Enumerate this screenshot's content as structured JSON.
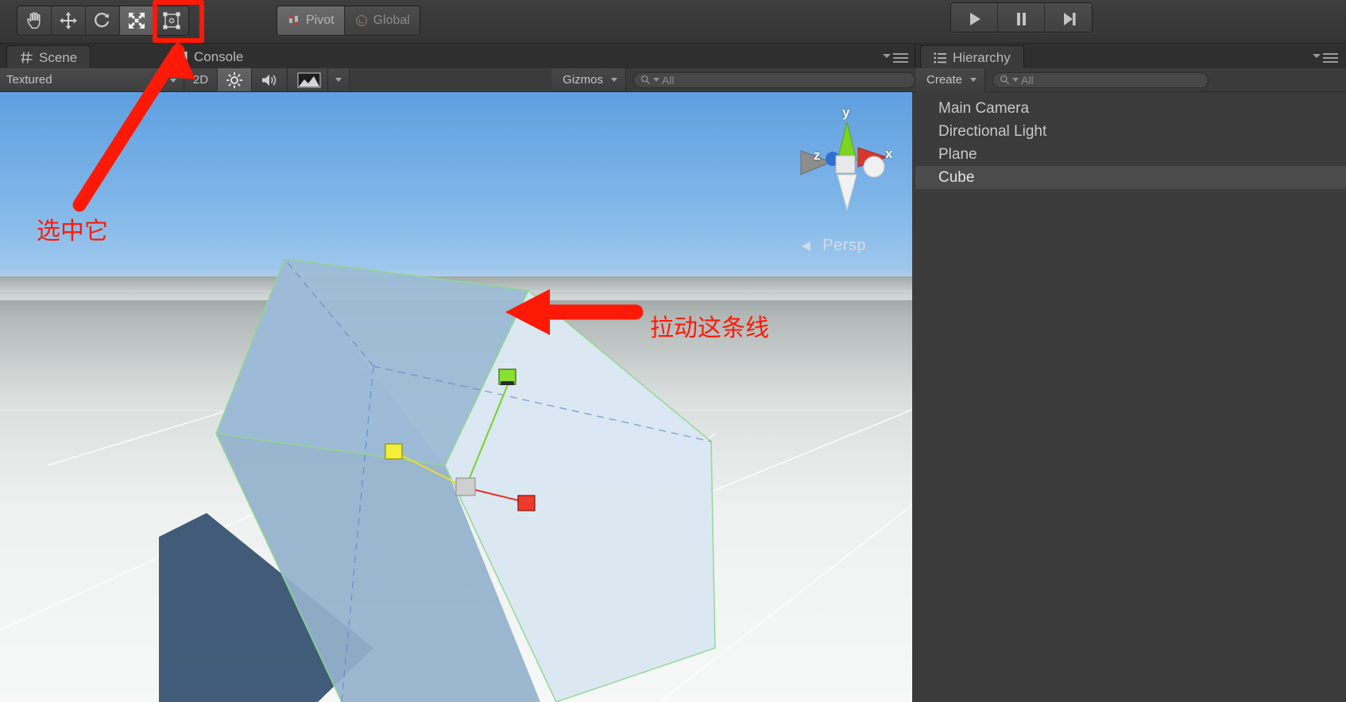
{
  "toolbar": {
    "transform_tools": [
      {
        "name": "hand-tool",
        "icon": "hand-icon",
        "active": false
      },
      {
        "name": "move-tool",
        "icon": "move-arrows-icon",
        "active": false
      },
      {
        "name": "rotate-tool",
        "icon": "rotate-icon",
        "active": false
      },
      {
        "name": "scale-tool",
        "icon": "scale-icon",
        "active": true
      },
      {
        "name": "rect-tool",
        "icon": "rect-transform-icon",
        "active": false
      }
    ],
    "pivot_label": "Pivot",
    "global_label": "Global",
    "play_controls": [
      {
        "name": "play-button",
        "icon": "play-icon"
      },
      {
        "name": "pause-button",
        "icon": "pause-icon"
      },
      {
        "name": "step-button",
        "icon": "step-forward-icon"
      }
    ]
  },
  "scene_panel": {
    "tabs": [
      {
        "label": "Scene",
        "icon": "grid-icon",
        "active": true
      },
      {
        "label": "Console",
        "icon": "console-icon",
        "active": false
      }
    ],
    "draw_mode": "Textured",
    "toggles": [
      {
        "label": "2D",
        "name": "toggle-2d",
        "active": false
      },
      {
        "label": "",
        "name": "lighting-toggle",
        "icon": "sun-icon",
        "active": true
      },
      {
        "label": "",
        "name": "audio-toggle",
        "icon": "speaker-icon",
        "active": false
      },
      {
        "label": "",
        "name": "effects-toggle",
        "icon": "image-icon",
        "active": false
      }
    ],
    "gizmos_label": "Gizmos",
    "search_value": "All",
    "search_placeholder": "All",
    "gizmo_axes": {
      "x": "x",
      "y": "y",
      "z": "z"
    },
    "camera_mode": "Persp"
  },
  "hierarchy_panel": {
    "tab_label": "Hierarchy",
    "tab_icon": "hierarchy-list-icon",
    "create_label": "Create",
    "search_value": "All",
    "search_placeholder": "All",
    "items": [
      {
        "label": "Main Camera",
        "selected": false
      },
      {
        "label": "Directional Light",
        "selected": false
      },
      {
        "label": "Plane",
        "selected": false
      },
      {
        "label": "Cube",
        "selected": true
      }
    ]
  },
  "annotations": {
    "color": "#fe1a07",
    "select_it": "选中它",
    "drag_this_line": "拉动这条线"
  },
  "colors": {
    "accent_red": "#fe1a07",
    "panel_bg": "#3b3b3b",
    "toolbar_bg": "#3e3e3e",
    "selection_bg": "#4b4b4b",
    "gizmo_x": "#e0342a",
    "gizmo_y": "#77d321",
    "gizmo_z": "#e8e02e",
    "sky_top": "#5f9fe0",
    "ground": "#f2f5f4"
  }
}
